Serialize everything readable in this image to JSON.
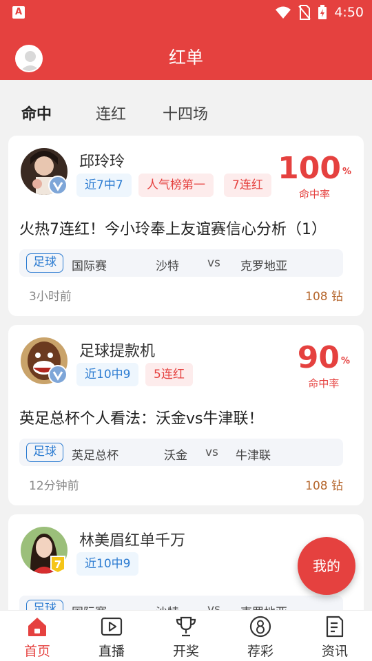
{
  "status_bar": {
    "time": "4:50",
    "app_icon": "A"
  },
  "header": {
    "title": "红单"
  },
  "tabs": [
    {
      "label": "命中",
      "active": true
    },
    {
      "label": "连红",
      "active": false
    },
    {
      "label": "十四场",
      "active": false
    }
  ],
  "cards": [
    {
      "author": "邱玲玲",
      "tags": [
        "近7中7",
        "人气榜第一",
        "7连红"
      ],
      "rate_value": "100",
      "rate_unit": "%",
      "rate_label": "命中率",
      "title": "火热7连红！今小玲奉上友谊赛信心分析（1）",
      "sport": "足球",
      "league": "国际赛",
      "home": "沙特",
      "vs": "vs",
      "away": "克罗地亚",
      "time_ago": "3小时前",
      "price": "108 钻"
    },
    {
      "author": "足球提款机",
      "tags": [
        "近10中9",
        "5连红"
      ],
      "rate_value": "90",
      "rate_unit": "%",
      "rate_label": "命中率",
      "title": "英足总杯个人看法：沃金vs牛津联！",
      "sport": "足球",
      "league": "英足总杯",
      "home": "沃金",
      "vs": "vs",
      "away": "牛津联",
      "time_ago": "12分钟前",
      "price": "108 钻"
    },
    {
      "author": "林美眉红单千万",
      "tags": [
        "近10中9"
      ],
      "badge_number": "7",
      "sport": "足球",
      "league": "国际赛",
      "home": "沙特",
      "vs": "vs",
      "away": "克罗地亚"
    }
  ],
  "fab": {
    "label": "我的"
  },
  "bottom_nav": [
    {
      "label": "首页",
      "icon": "home-icon",
      "active": true
    },
    {
      "label": "直播",
      "icon": "play-icon",
      "active": false
    },
    {
      "label": "开奖",
      "icon": "trophy-icon",
      "active": false
    },
    {
      "label": "荐彩",
      "icon": "eight-ball-icon",
      "active": false
    },
    {
      "label": "资讯",
      "icon": "news-icon",
      "active": false
    }
  ],
  "colors": {
    "brand": "#e5413f",
    "blue_tag": "#2b7bd1",
    "price": "#b5652b"
  }
}
